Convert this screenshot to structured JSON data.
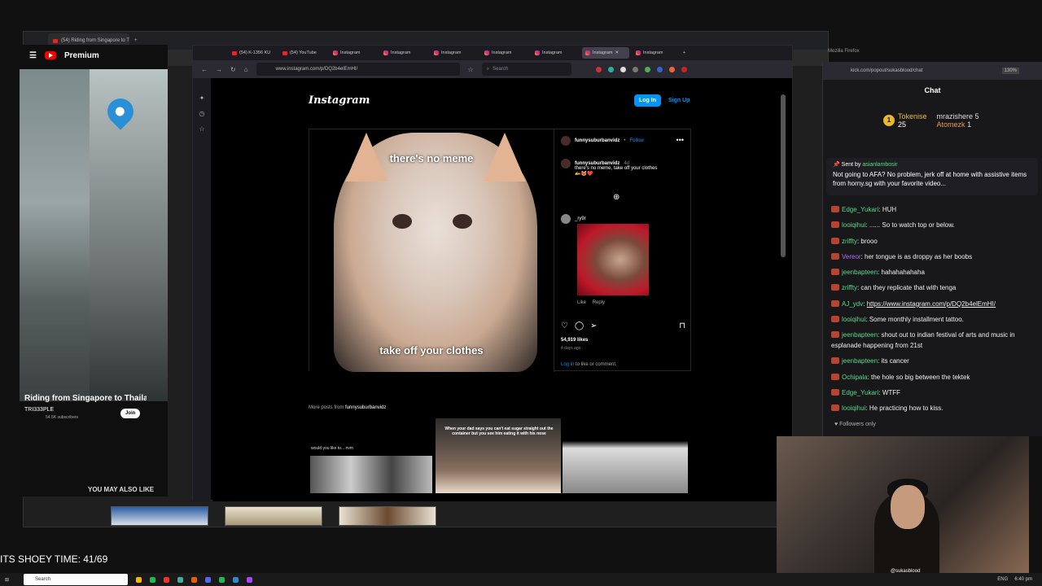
{
  "back_browser": {
    "tab_title": "(54) Riding from Singapore to T",
    "yt_brand": "Premium",
    "video_title": "Riding from Singapore to Thailand",
    "channel_name": "TRI333PLE",
    "channel_subs": "54.5K subscribers",
    "join_label": "Join",
    "also_like": "YOU MAY ALSO LIKE"
  },
  "browser": {
    "tabs": [
      {
        "label": "(54) K-1356 KU"
      },
      {
        "label": "(54) YouTube"
      },
      {
        "label": "Instagram"
      },
      {
        "label": "Instagram"
      },
      {
        "label": "Instagram"
      },
      {
        "label": "Instagram"
      },
      {
        "label": "Instagram"
      },
      {
        "label": "Instagram",
        "active": true
      },
      {
        "label": "Instagram"
      }
    ],
    "url": "www.instagram.com/p/DQ2b4elEmHI/",
    "search_placeholder": "Search"
  },
  "instagram": {
    "logo": "Instagram",
    "login_label": "Log In",
    "signup_label": "Sign Up",
    "post": {
      "author": "funnysuburbanvidz",
      "follow": "Follow",
      "meme_top": "there's no meme",
      "meme_bottom": "take off your clothes",
      "caption_author": "funnysuburbanvidz",
      "caption_age": "4d",
      "caption_text": "there's no meme, take off your clothes",
      "caption_emoji": "🫴😻❤️",
      "commenter": "_ry9r",
      "like_label": "Like",
      "reply_label": "Reply",
      "likes": "54,919 likes",
      "posted_ago": "4 days ago",
      "login_prompt_link": "Log in",
      "login_prompt_rest": "to like or comment."
    },
    "more_posts_prefix": "More posts from",
    "more_posts_user": "funnysuburbanvidz",
    "grid": [
      {
        "caption": "would you like to... nvm"
      },
      {
        "caption": "When your dad says you can't eat sugar straight out the container but you see him eating it with his nose"
      },
      {
        "caption": ""
      }
    ]
  },
  "chat": {
    "url": "kick.com/popout/sukasblood/chat",
    "zoom": "130%",
    "window_label": "Mozilla Firefox",
    "title": "Chat",
    "leaders": [
      {
        "name": "Tokenise",
        "count": "25"
      },
      {
        "name": "mrazishere",
        "count": "5"
      },
      {
        "name": "Atomezk",
        "count": "1"
      }
    ],
    "pinned_by_prefix": "Sent by",
    "pinned_by": "asianlambosir",
    "pinned_text": "Not going to AFA? No problem, jerk off at home with assistive items from horny.sg with your favorite video...",
    "messages": [
      {
        "user": "Edge_Yukari",
        "color": "#57d98a",
        "text": "HUH"
      },
      {
        "user": "looiqihui",
        "color": "#57d98a",
        "text": "...... So to watch top or below."
      },
      {
        "user": "zriffty",
        "color": "#57d98a",
        "text": "brooo"
      },
      {
        "user": "Vereor",
        "color": "#b36cf5",
        "text": "her tongue is as droppy as her boobs"
      },
      {
        "user": "jeenbapteen",
        "color": "#57d98a",
        "text": "hahahahahaha"
      },
      {
        "user": "zriffty",
        "color": "#57d98a",
        "text": "can they replicate that with tenga"
      },
      {
        "user": "AJ_ydv",
        "color": "#57d98a",
        "text": "https://www.instagram.com/p/DQ2b4elEmHI/"
      },
      {
        "user": "looiqihui",
        "color": "#57d98a",
        "text": "Some monthly installment tattoo."
      },
      {
        "user": "jeenbapteen",
        "color": "#57d98a",
        "text": "shout out to indian festival of arts and music in esplanade happening from 21st"
      },
      {
        "user": "jeenbapteen",
        "color": "#57d98a",
        "text": "its cancer"
      },
      {
        "user": "Ochipala",
        "color": "#57d98a",
        "text": "the hole so big between the tektek"
      },
      {
        "user": "Edge_Yukari",
        "color": "#57d98a",
        "text": "WTFF"
      },
      {
        "user": "looiqihui",
        "color": "#57d98a",
        "text": "He practicing how to kiss."
      }
    ],
    "followers_only": "Followers only"
  },
  "webcam": {
    "handle": "@sukasblood"
  },
  "overlay_counter": "ITS SHOEY TIME: 41/69",
  "taskbar": {
    "search": "Search",
    "lang": "ENG",
    "time": "6:40 pm"
  }
}
